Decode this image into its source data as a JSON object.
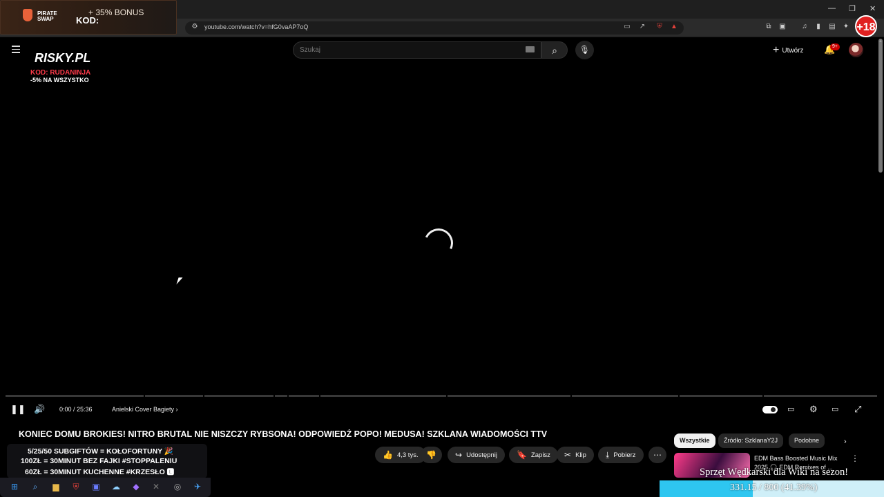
{
  "browser": {
    "url": "youtube.com/watch?v=hfG0vaAP7oQ",
    "window_controls": [
      "—",
      "❐",
      "✕"
    ]
  },
  "overlays": {
    "pirate": {
      "name": "PIRATE SWAP",
      "bonus": "+ 35% BONUS",
      "kod_label": "KOD:"
    },
    "risky": {
      "logo": "RISKY.PL",
      "code": "KOD: RUDANINJA",
      "promo": "-5% NA WSZYSTKO"
    },
    "age_badge": "+18",
    "goals": {
      "lines": [
        "5/25/50 SUBGIFTÓW = KOŁOFORTUNY 🎉",
        "100ZŁ = 30MINUT BEZ FAJKI #STOPPALENIU",
        "60ZŁ = 30MINUT KUCHENNE #KRZESŁO 🅻"
      ]
    },
    "goal_bar": {
      "title": "Sprzęt Wędkarski dla Wiki na sezon!",
      "current": "331.15",
      "target": "800",
      "percent_text": "(41.39%)",
      "fraction": 0.4139,
      "fill_color": "#2ec6f0",
      "track_color": "#cfeff8"
    }
  },
  "youtube": {
    "search_placeholder": "Szukaj",
    "create_label": "Utwórz",
    "notifications_badge": "9+",
    "player": {
      "time": "0:00 / 25:36",
      "chapter": "Anielski Cover Bagiety"
    },
    "video_title": "KONIEC DOMU BROKIES! NITRO BRUTAL NIE NISZCZY RYBSONA! ODPOWIEDŹ POPO! MEDUSA! SZKLANA WIADOMOŚCI TTV",
    "actions": {
      "likes": "4,3 tys.",
      "share": "Udostępnij",
      "save": "Zapisz",
      "clip": "Klip",
      "download": "Pobierz"
    },
    "chips": [
      "Wszystkie",
      "Źródło: SzklanaY2J",
      "Podobne"
    ],
    "recommended": [
      {
        "title": "EDM Bass Boosted Music Mix 2025 🎧 EDM Remixes of ..."
      }
    ]
  },
  "colors": {
    "background": "#000000",
    "accent": "#ff0000"
  },
  "icons": [
    "hamburger-icon",
    "search-icon",
    "mic-icon",
    "bell-icon",
    "pause-icon",
    "volume-icon",
    "settings-icon",
    "fullscreen-icon",
    "like-icon",
    "dislike-icon",
    "share-icon",
    "save-icon",
    "clip-icon",
    "download-icon"
  ]
}
